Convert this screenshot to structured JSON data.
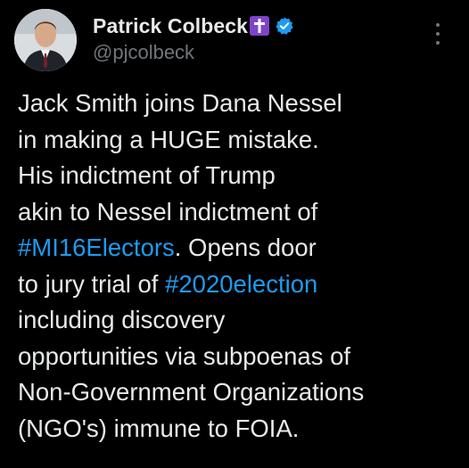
{
  "author": {
    "display_name": "Patrick Colbeck",
    "handle": "@pjcolbeck",
    "name_emoji_icon": "latin-cross-icon",
    "verified_icon": "verified-badge-icon",
    "avatar_icon": "profile-photo"
  },
  "menu": {
    "icon": "more-vertical-icon"
  },
  "tweet": {
    "lines": [
      [
        {
          "text": "Jack Smith joins Dana Nessel"
        }
      ],
      [
        {
          "text": "in making a HUGE mistake."
        }
      ],
      [
        {
          "text": "His indictment of Trump"
        }
      ],
      [
        {
          "text": "akin to Nessel indictment of"
        }
      ],
      [
        {
          "text": "#MI16Electors",
          "hashtag": true
        },
        {
          "text": ". Opens door"
        }
      ],
      [
        {
          "text": "to jury trial of "
        },
        {
          "text": "#2020election",
          "hashtag": true
        }
      ],
      [
        {
          "text": "including discovery"
        }
      ],
      [
        {
          "text": "opportunities via subpoenas of"
        }
      ],
      [
        {
          "text": "Non-Government Organizations"
        }
      ],
      [
        {
          "text": "(NGO's) immune to FOIA."
        }
      ]
    ]
  },
  "colors": {
    "background": "#000000",
    "text": "#e7e9ea",
    "secondary_text": "#71767b",
    "link": "#1d9bf0",
    "verified": "#1d9bf0",
    "cross_emoji_bg": "#7e44c8"
  }
}
